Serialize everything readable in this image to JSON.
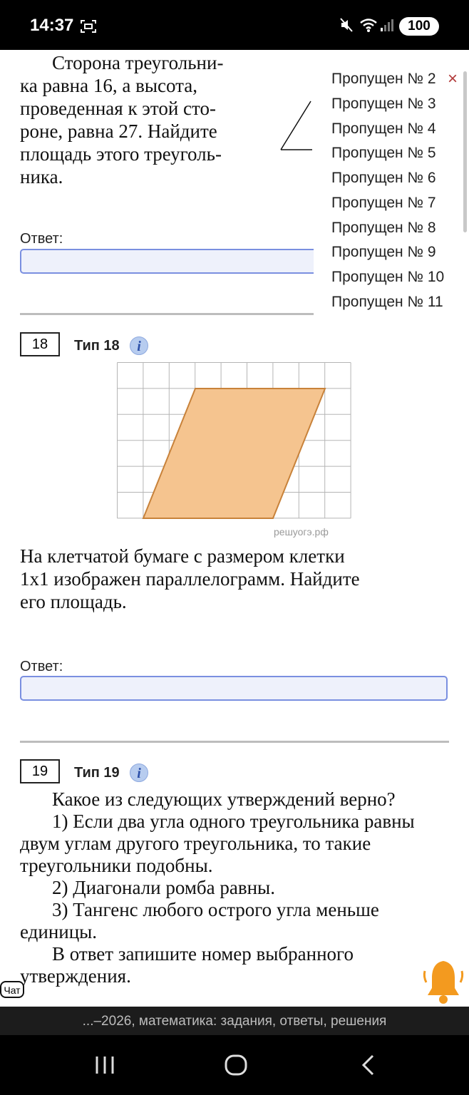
{
  "status_bar": {
    "time": "14:37",
    "battery": "100"
  },
  "task17": {
    "lines": [
      "Сторона треугольни-",
      "ка равна 16, а высота,",
      "проведенная к этой сто-",
      "роне, равна 27. Найдите",
      "площадь этого треуголь-",
      "ника."
    ],
    "answer_label": "Ответ:"
  },
  "missing_list": {
    "items": [
      "Пропущен № 2",
      "Пропущен № 3",
      "Пропущен № 4",
      "Пропущен № 5",
      "Пропущен № 6",
      "Пропущен № 7",
      "Пропущен № 8",
      "Пропущен № 9",
      "Пропущен № 10",
      "Пропущен № 11"
    ],
    "close_symbol": "×"
  },
  "task18": {
    "number": "18",
    "type_label": "Тип 18",
    "info_symbol": "i",
    "figure_watermark": "решуогэ.рф",
    "text_lines": [
      "На клетчатой бумаге с размером клетки",
      "1x1 изображен параллелограмм. Найдите",
      "его площадь."
    ],
    "answer_label": "Ответ:"
  },
  "task19": {
    "number": "19",
    "type_label": "Тип 19",
    "info_symbol": "i",
    "paragraphs": [
      "Какое из следующих утверждений верно?",
      "1)  Если два угла одного треугольника равны двум углам другого треугольника, то такие треугольники подобны.",
      "2)  Диагонали ромба равны.",
      "3)  Тангенс любого острого угла меньше единицы.",
      "В ответ запишите номер выбранного утверждения."
    ]
  },
  "chat_label": "Чат",
  "footer": {
    "text": "...–2026, математика: задания, ответы, решения"
  },
  "colors": {
    "parallelogram_fill": "#f5c48f",
    "parallelogram_stroke": "#c8823a",
    "accent_blue": "#7a8fe0"
  }
}
